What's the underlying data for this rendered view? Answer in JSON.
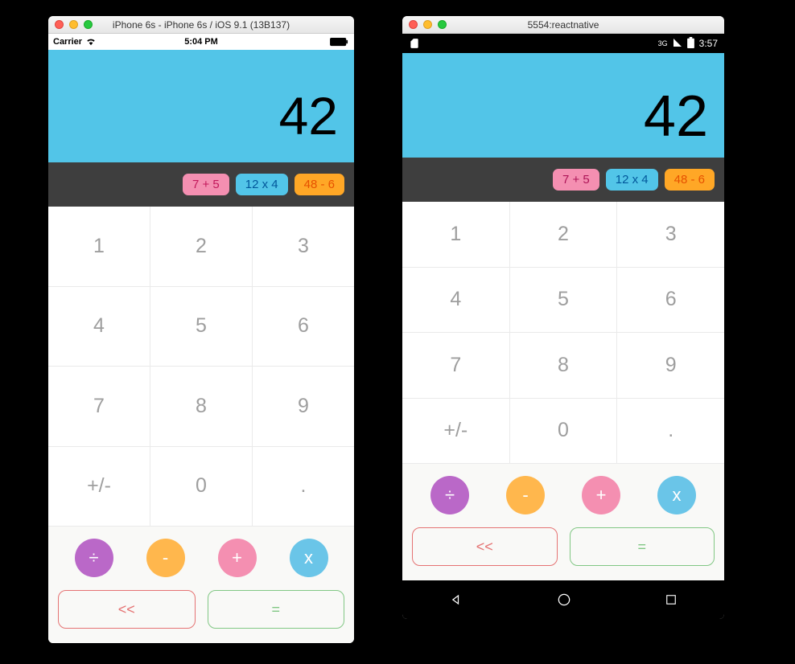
{
  "ios": {
    "windowTitle": "iPhone 6s - iPhone 6s / iOS 9.1 (13B137)",
    "status": {
      "carrier": "Carrier",
      "time": "5:04 PM"
    },
    "display": "42",
    "history": [
      {
        "label": "7 + 5",
        "cls": "chip-pink"
      },
      {
        "label": "12 x 4",
        "cls": "chip-blue"
      },
      {
        "label": "48 - 6",
        "cls": "chip-orange"
      }
    ],
    "numRows": [
      [
        "1",
        "2",
        "3"
      ],
      [
        "4",
        "5",
        "6"
      ],
      [
        "7",
        "8",
        "9"
      ],
      [
        "+/-",
        "0",
        "."
      ]
    ],
    "ops": [
      {
        "label": "÷",
        "cls": "op-purple",
        "name": "divide-button"
      },
      {
        "label": "-",
        "cls": "op-orange",
        "name": "subtract-button"
      },
      {
        "label": "+",
        "cls": "op-pink",
        "name": "add-button"
      },
      {
        "label": "x",
        "cls": "op-blue",
        "name": "multiply-button"
      }
    ],
    "back": "<<",
    "equals": "="
  },
  "android": {
    "windowTitle": "5554:reactnative",
    "status": {
      "network": "3G",
      "time": "3:57"
    },
    "display": "42",
    "history": [
      {
        "label": "7 + 5",
        "cls": "chip-pink"
      },
      {
        "label": "12 x 4",
        "cls": "chip-blue"
      },
      {
        "label": "48 - 6",
        "cls": "chip-orange"
      }
    ],
    "numRows": [
      [
        "1",
        "2",
        "3"
      ],
      [
        "4",
        "5",
        "6"
      ],
      [
        "7",
        "8",
        "9"
      ],
      [
        "+/-",
        "0",
        "."
      ]
    ],
    "ops": [
      {
        "label": "÷",
        "cls": "op-purple",
        "name": "divide-button"
      },
      {
        "label": "-",
        "cls": "op-orange",
        "name": "subtract-button"
      },
      {
        "label": "+",
        "cls": "op-pink",
        "name": "add-button"
      },
      {
        "label": "x",
        "cls": "op-blue",
        "name": "multiply-button"
      }
    ],
    "back": "<<",
    "equals": "="
  }
}
